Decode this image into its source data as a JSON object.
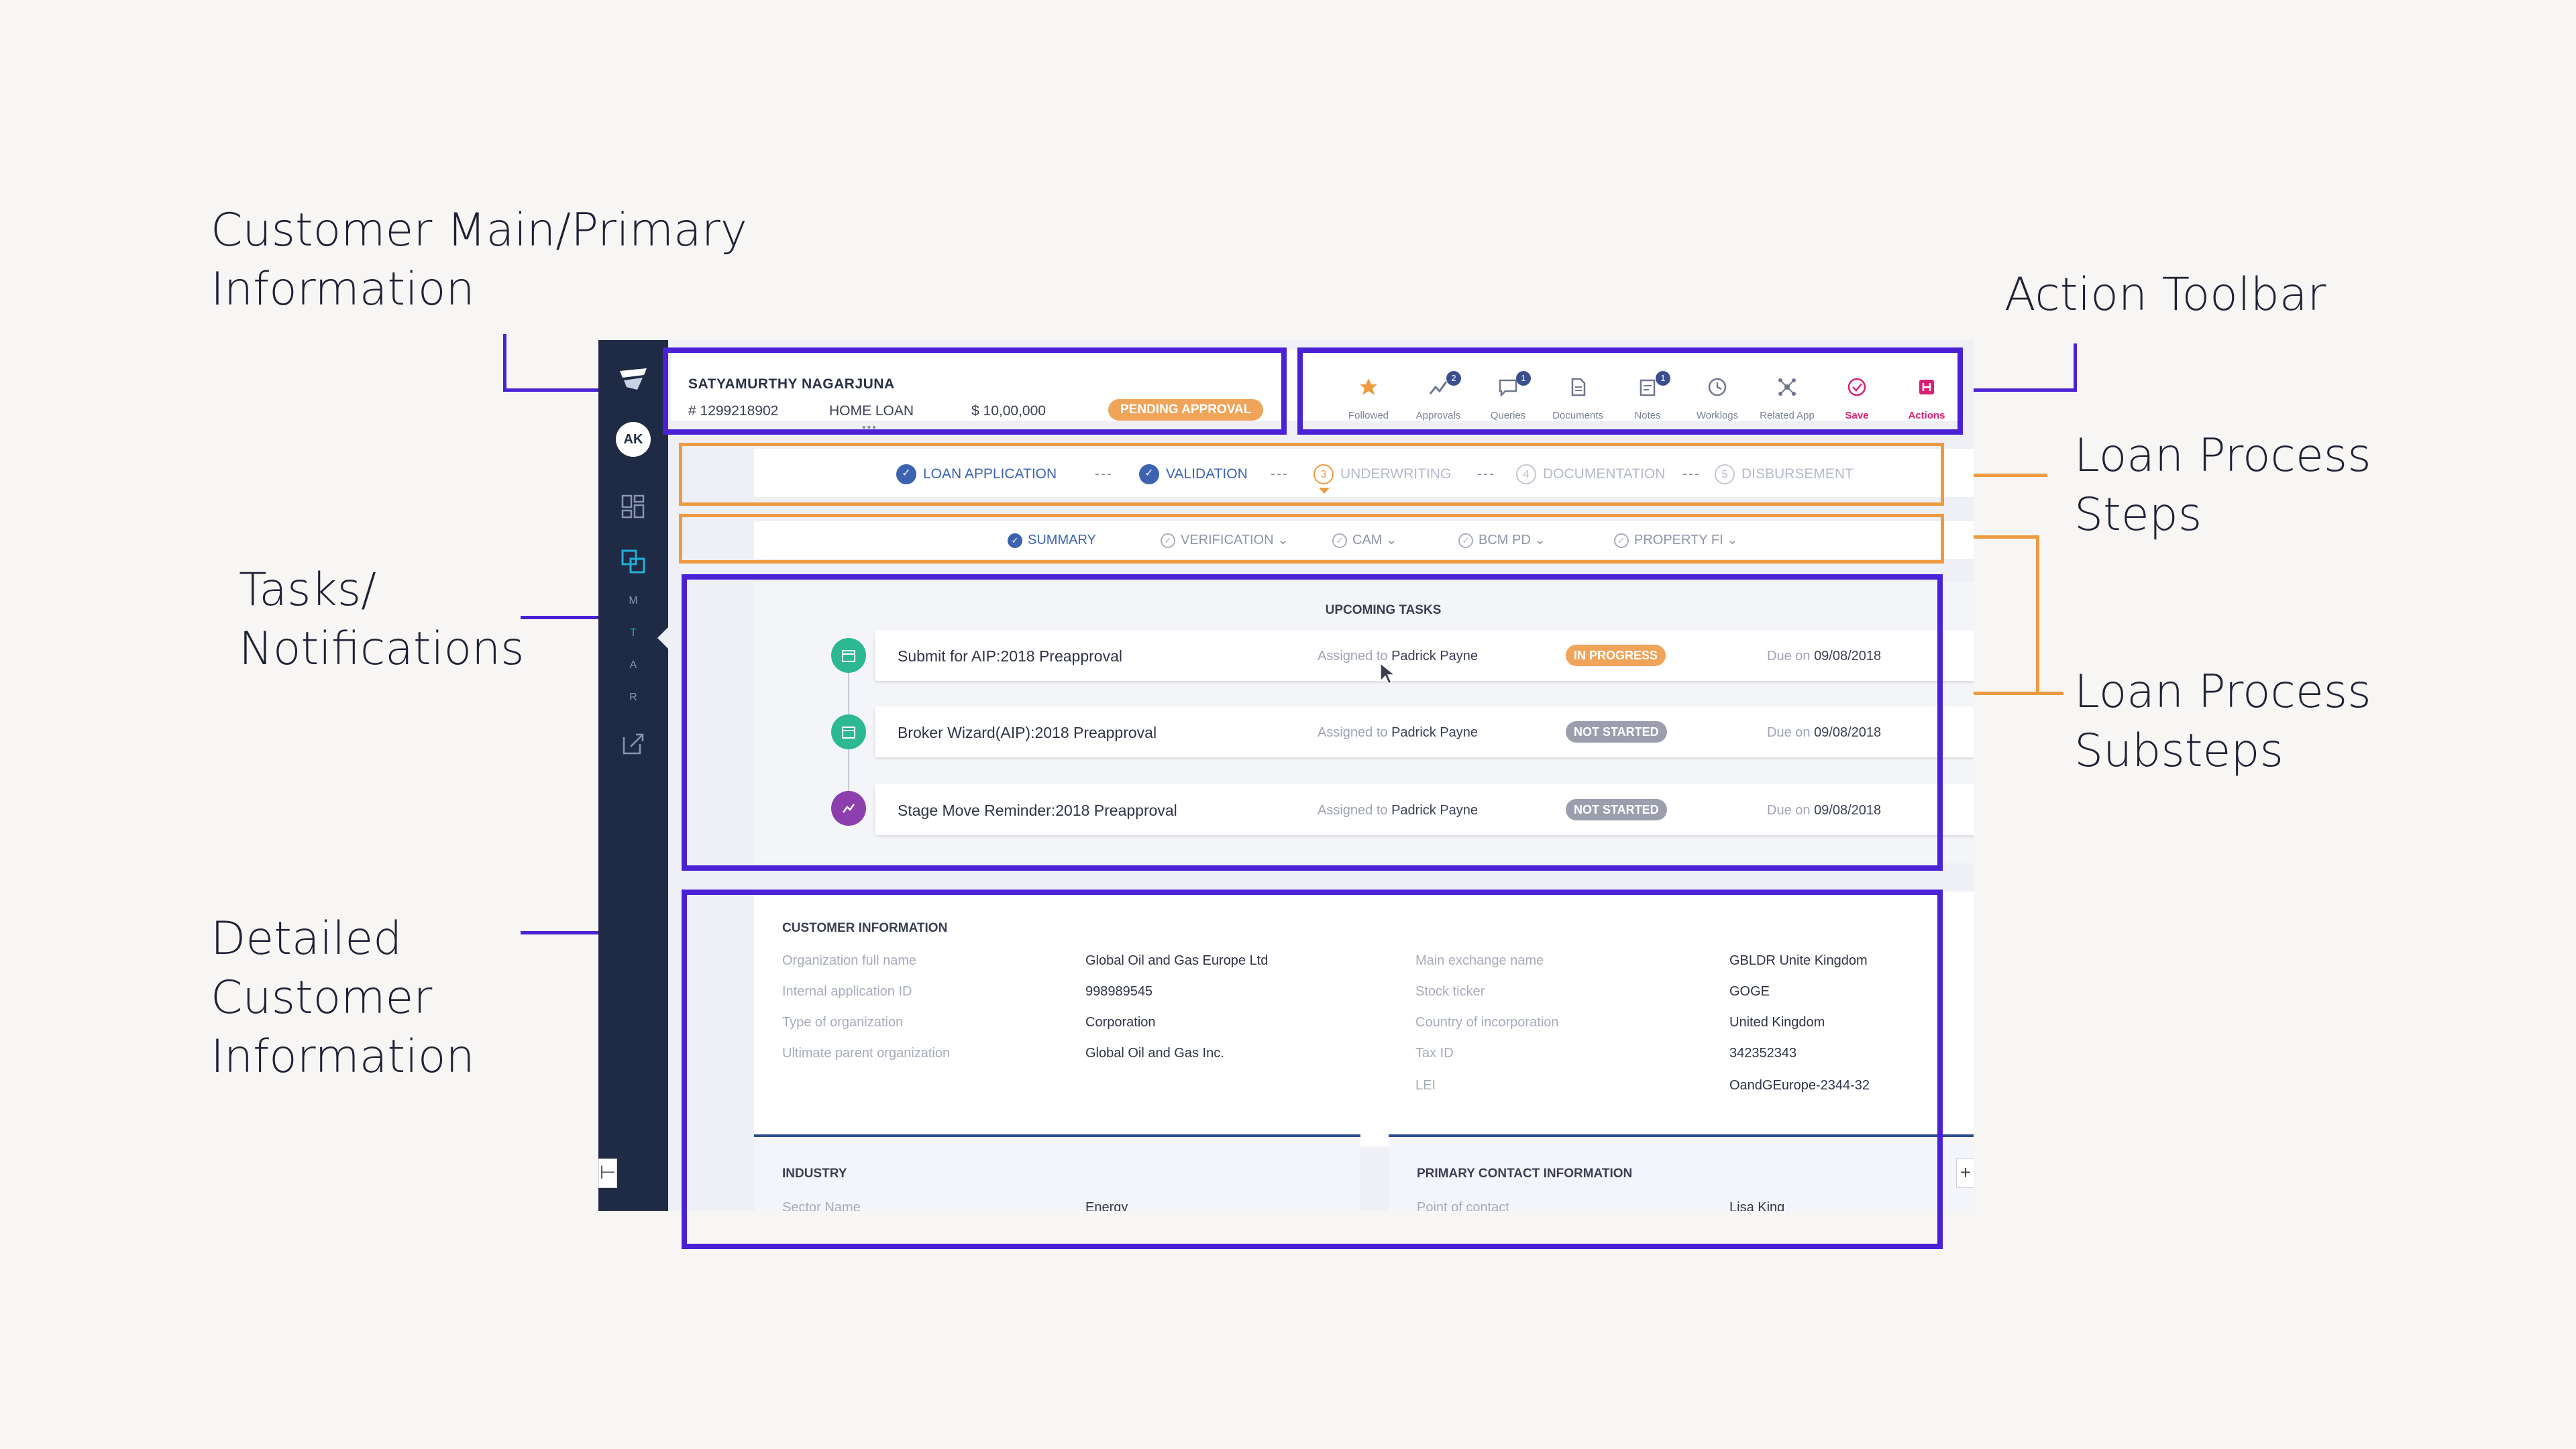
{
  "annotations": {
    "primary_info": "Customer Main/Primary\nInformation",
    "action_toolbar": "Action Toolbar",
    "process_steps": "Loan Process\nSteps",
    "process_substeps": "Loan Process\nSubsteps",
    "tasks": "Tasks/\nNotifications",
    "detailed_info": "Detailed\nCustomer\nInformation"
  },
  "sidebar": {
    "avatar": "AK",
    "letters": [
      "M",
      "T",
      "A",
      "R"
    ]
  },
  "customer": {
    "name": "SATYAMURTHY NAGARJUNA",
    "id": "# 1299218902",
    "loan_type": "HOME LOAN",
    "amount": "$ 10,00,000",
    "status": "PENDING APPROVAL",
    "more": "•••"
  },
  "toolbar": [
    {
      "label": "Followed",
      "icon": "star-icon",
      "badge": ""
    },
    {
      "label": "Approvals",
      "icon": "approvals-icon",
      "badge": "2"
    },
    {
      "label": "Queries",
      "icon": "chat-icon",
      "badge": "1"
    },
    {
      "label": "Documents",
      "icon": "document-icon",
      "badge": ""
    },
    {
      "label": "Notes",
      "icon": "notes-icon",
      "badge": "1"
    },
    {
      "label": "Worklogs",
      "icon": "clock-icon",
      "badge": ""
    },
    {
      "label": "Related App",
      "icon": "network-icon",
      "badge": ""
    },
    {
      "label": "Save",
      "icon": "check-circle-icon",
      "badge": ""
    },
    {
      "label": "Actions",
      "icon": "actions-icon",
      "badge": ""
    }
  ],
  "steps": [
    {
      "num": "✓",
      "label": "LOAN APPLICATION",
      "state": "done"
    },
    {
      "num": "✓",
      "label": "VALIDATION",
      "state": "done"
    },
    {
      "num": "3",
      "label": "UNDERWRITING",
      "state": "current"
    },
    {
      "num": "4",
      "label": "DOCUMENTATION",
      "state": "todo"
    },
    {
      "num": "5",
      "label": "DISBURSEMENT",
      "state": "todo"
    }
  ],
  "step_separator": "---",
  "substeps": [
    {
      "label": "SUMMARY",
      "state": "active"
    },
    {
      "label": "VERIFICATION ⌄",
      "state": "todo"
    },
    {
      "label": "CAM ⌄",
      "state": "todo"
    },
    {
      "label": "BCM PD ⌄",
      "state": "todo"
    },
    {
      "label": "PROPERTY FI ⌄",
      "state": "todo"
    }
  ],
  "tasks": {
    "title": "UPCOMING TASKS",
    "assigned_prefix": "Assigned to",
    "due_prefix": "Due on",
    "items": [
      {
        "name": "Submit for AIP:2018 Preapproval",
        "assignee": "Padrick Payne",
        "status": "IN PROGRESS",
        "due": "09/08/2018",
        "color": "#2bb893"
      },
      {
        "name": "Broker Wizard(AIP):2018 Preapproval",
        "assignee": "Padrick Payne",
        "status": "NOT STARTED",
        "due": "09/08/2018",
        "color": "#2bb893"
      },
      {
        "name": "Stage Move Reminder:2018 Preapproval",
        "assignee": "Padrick Payne",
        "status": "NOT STARTED",
        "due": "09/08/2018",
        "color": "#8e3fae"
      }
    ]
  },
  "customer_info": {
    "title": "CUSTOMER INFORMATION",
    "left": [
      {
        "label": "Organization full name",
        "value": "Global Oil and Gas Europe Ltd"
      },
      {
        "label": "Internal application ID",
        "value": "998989545"
      },
      {
        "label": "Type of organization",
        "value": "Corporation"
      },
      {
        "label": "Ultimate parent organization",
        "value": "Global Oil and Gas Inc."
      }
    ],
    "right": [
      {
        "label": "Main exchange name",
        "value": "GBLDR Unite Kingdom"
      },
      {
        "label": "Stock ticker",
        "value": "GOGE"
      },
      {
        "label": "Country of incorporation",
        "value": "United Kingdom"
      },
      {
        "label": "Tax ID",
        "value": "342352343"
      },
      {
        "label": "LEI",
        "value": "OandGEurope-2344-32"
      }
    ]
  },
  "industry": {
    "title": "INDUSTRY",
    "label": "Sector Name",
    "value": "Energy"
  },
  "primary_contact": {
    "title": "PRIMARY CONTACT INFORMATION",
    "label": "Point of contact",
    "value": "Lisa King"
  },
  "colors": {
    "highlight": "#4b21d6",
    "orange": "#ee9a40",
    "sidebar": "#1f2a44",
    "accent": "#3b63b0"
  }
}
